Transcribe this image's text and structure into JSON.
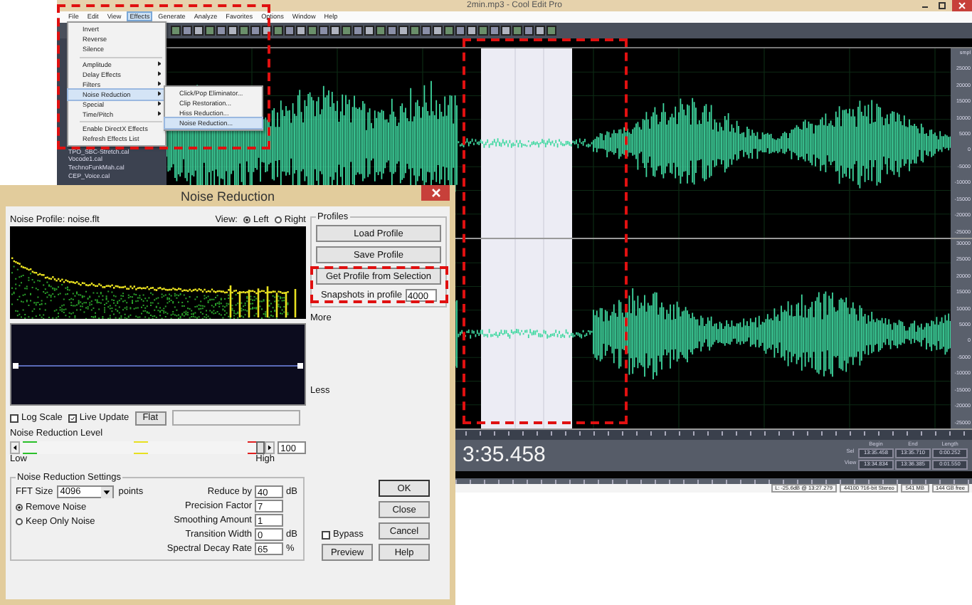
{
  "app_window": {
    "title": "2min.mp3 - Cool Edit Pro",
    "menu": [
      {
        "label": "File",
        "selected": false
      },
      {
        "label": "Edit",
        "selected": false
      },
      {
        "label": "View",
        "selected": false
      },
      {
        "label": "Effects",
        "selected": true
      },
      {
        "label": "Generate",
        "selected": false
      },
      {
        "label": "Analyze",
        "selected": false
      },
      {
        "label": "Favorites",
        "selected": false
      },
      {
        "label": "Options",
        "selected": false
      },
      {
        "label": "Window",
        "selected": false
      },
      {
        "label": "Help",
        "selected": false
      }
    ],
    "file_list": [
      "TPO_SBC-Stretch.cal",
      "Vocode1.cal",
      "TechnoFunkMah.cal",
      "CEP_Voice.cal"
    ],
    "amplitude_scales": [
      [
        "smpl",
        "25000",
        "20000",
        "15000",
        "10000",
        "5000",
        "0",
        "-5000",
        "-10000",
        "-15000",
        "-20000",
        "-25000"
      ],
      [
        "30000",
        "25000",
        "20000",
        "15000",
        "10000",
        "5000",
        "0",
        "-5000",
        "-10000",
        "-15000",
        "-20000",
        "-25000"
      ]
    ],
    "time_display": "3:35.458",
    "selection_info": {
      "columns": [
        "Begin",
        "End",
        "Length"
      ],
      "rows": [
        {
          "label": "Sel",
          "values": [
            "13:35.458",
            "13:35.710",
            "0:00.252"
          ]
        },
        {
          "label": "View",
          "values": [
            "13:34.834",
            "13:36.385",
            "0:01.550"
          ]
        }
      ]
    },
    "status_bar": [
      "L: -25.6dB @ 13:27.279",
      "44100 ?16-bit Stereo",
      "541 MB",
      "144 GB free"
    ]
  },
  "effects_menu": [
    {
      "kind": "item",
      "label": "Invert",
      "selected": false
    },
    {
      "kind": "item",
      "label": "Reverse",
      "selected": false
    },
    {
      "kind": "item",
      "label": "Silence",
      "selected": false
    },
    {
      "kind": "separator"
    },
    {
      "kind": "submenu",
      "label": "Amplitude",
      "selected": false
    },
    {
      "kind": "submenu",
      "label": "Delay Effects",
      "selected": false
    },
    {
      "kind": "submenu",
      "label": "Filters",
      "selected": false
    },
    {
      "kind": "submenu",
      "label": "Noise Reduction",
      "selected": true
    },
    {
      "kind": "submenu",
      "label": "Special",
      "selected": false
    },
    {
      "kind": "submenu",
      "label": "Time/Pitch",
      "selected": false
    },
    {
      "kind": "separator"
    },
    {
      "kind": "item",
      "label": "Enable DirectX Effects",
      "selected": false
    },
    {
      "kind": "item",
      "label": "Refresh Effects List",
      "selected": false
    }
  ],
  "noise_reduction_submenu": [
    {
      "label": "Click/Pop Eliminator...",
      "selected": false
    },
    {
      "label": "Clip Restoration...",
      "selected": false
    },
    {
      "label": "Hiss Reduction...",
      "selected": false
    },
    {
      "label": "Noise Reduction...",
      "selected": true
    }
  ],
  "dialog": {
    "title": "Noise Reduction",
    "noise_profile": "Noise Profile: noise.flt",
    "view_label": "View:",
    "view_options": [
      {
        "label": "Left",
        "selected": true
      },
      {
        "label": "Right",
        "selected": false
      }
    ],
    "graph_labels": {
      "more": "More",
      "less": "Less"
    },
    "log_scale": {
      "label": "Log Scale",
      "checked": false
    },
    "live_update": {
      "label": "Live Update",
      "checked": true
    },
    "flat_button": "Flat",
    "level": {
      "label": "Noise Reduction Level",
      "level": 1,
      "value": "100",
      "low": "Low",
      "high": "High"
    },
    "profiles": {
      "title": "Profiles",
      "buttons": [
        "Load Profile",
        "Save Profile",
        "Get Profile from Selection"
      ],
      "snapshots_label": "Snapshots in profile",
      "snapshots_value": "4000"
    },
    "settings": {
      "title": "Noise Reduction Settings",
      "fft_label": "FFT Size",
      "fft_value": "4096",
      "fft_unit": "points",
      "modes": [
        {
          "label": "Remove Noise",
          "selected": true
        },
        {
          "label": "Keep Only Noise",
          "selected": false
        }
      ],
      "fields": [
        {
          "label": "Reduce by",
          "value": "40",
          "unit": "dB"
        },
        {
          "label": "Precision Factor",
          "value": "7"
        },
        {
          "label": "Smoothing Amount",
          "value": "1"
        },
        {
          "label": "Transition Width",
          "value": "0",
          "unit": "dB"
        },
        {
          "label": "Spectral Decay Rate",
          "value": "65",
          "unit": "%"
        }
      ]
    },
    "bypass": {
      "label": "Bypass",
      "checked": false
    },
    "preview_button": "Preview",
    "buttons": [
      "OK",
      "Close",
      "Cancel",
      "Help"
    ]
  }
}
